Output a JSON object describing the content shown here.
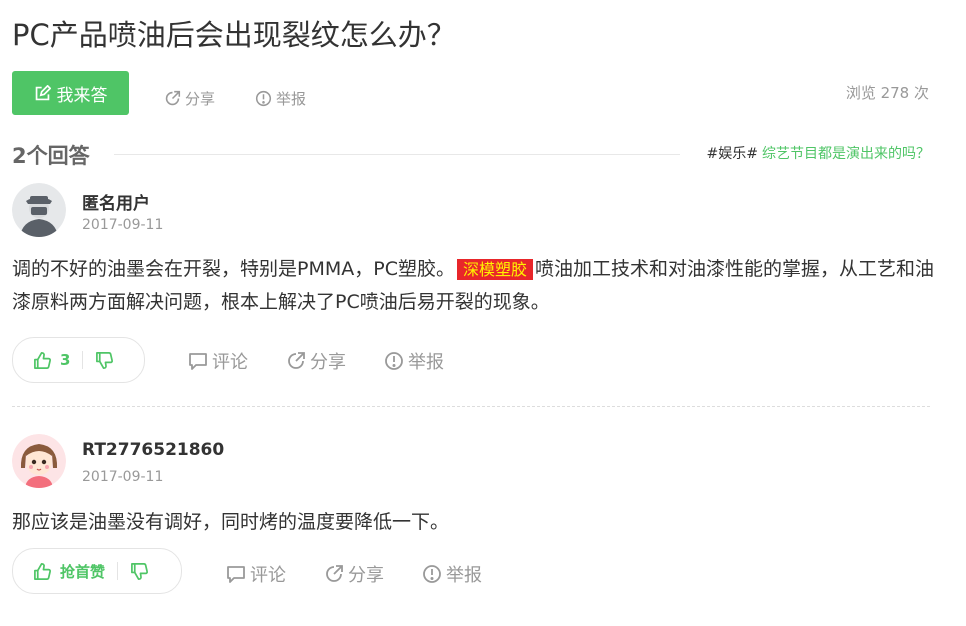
{
  "question": {
    "title": "PC产品喷油后会出现裂纹怎么办？"
  },
  "toolbar": {
    "answer_label": "我来答",
    "share_label": "分享",
    "report_label": "举报",
    "views": "浏览 278 次"
  },
  "answers_header": {
    "count_label": "2个回答",
    "hot_tag": "#娱乐#",
    "hot_question": "综艺节目都是演出来的吗？"
  },
  "answers": [
    {
      "user": "匿名用户",
      "date": "2017-09-11",
      "content_before": "调的不好的油墨会在开裂，特别是PMMA，PC塑胶。",
      "ad_label": "深模塑胶",
      "content_after": "喷油加工技术和对油漆性能的掌握，从工艺和油漆原料两方面解决问题，根本上解决了PC喷油后易开裂的现象。",
      "likes": "3",
      "comment_label": "评论",
      "share_label": "分享",
      "report_label": "举报"
    },
    {
      "user": "RT2776521860",
      "date": "2017-09-11",
      "content": "那应该是油墨没有调好，同时烤的温度要降低一下。",
      "like_label": "抢首赞",
      "comment_label": "评论",
      "share_label": "分享",
      "report_label": "举报"
    }
  ],
  "colors": {
    "green": "#4fc566",
    "gray": "#999999",
    "ad_bg": "#e8262a",
    "ad_text": "#fff200"
  },
  "icons": [
    "edit-icon",
    "share-icon",
    "report-icon",
    "thumbs-up-icon",
    "thumbs-down-icon",
    "comment-icon"
  ]
}
